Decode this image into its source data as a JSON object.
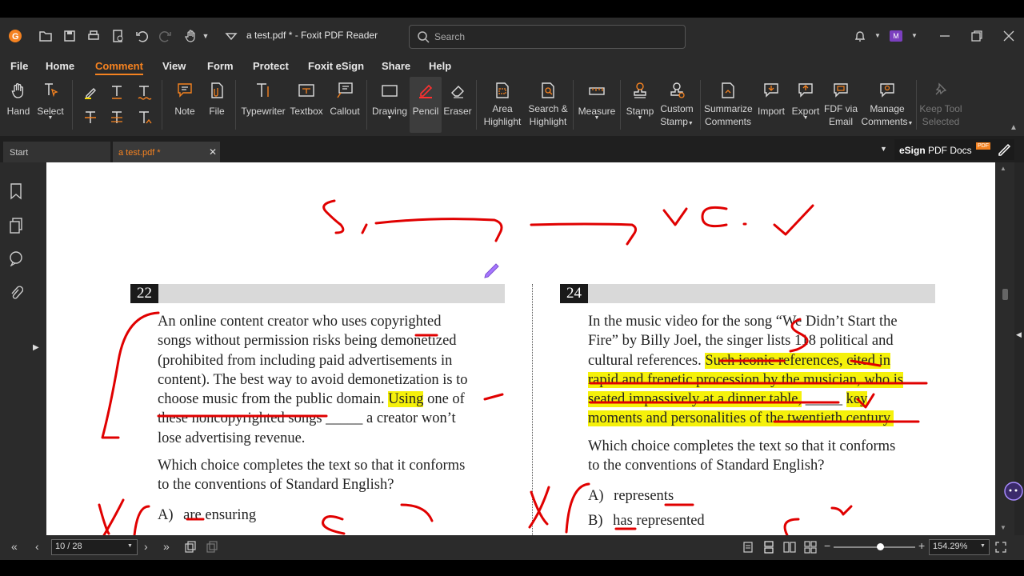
{
  "app": {
    "doc_title": "a test.pdf * - Foxit PDF Reader",
    "search_placeholder": "Search",
    "user_initial": "M"
  },
  "menu": [
    "File",
    "Home",
    "Comment",
    "View",
    "Form",
    "Protect",
    "Foxit eSign",
    "Share",
    "Help"
  ],
  "ribbon": {
    "hand": "Hand",
    "select": "Select",
    "note": "Note",
    "file": "File",
    "typewriter": "Typewriter",
    "textbox": "Textbox",
    "callout": "Callout",
    "drawing": "Drawing",
    "pencil": "Pencil",
    "eraser": "Eraser",
    "area_highlight_1": "Area",
    "area_highlight_2": "Highlight",
    "search_highlight_1": "Search &",
    "search_highlight_2": "Highlight",
    "measure": "Measure",
    "stamp": "Stamp",
    "custom_stamp_1": "Custom",
    "custom_stamp_2": "Stamp",
    "summarize_1": "Summarize",
    "summarize_2": "Comments",
    "import": "Import",
    "export": "Export",
    "fdf_1": "FDF via",
    "fdf_2": "Email",
    "manage_1": "Manage",
    "manage_2": "Comments",
    "keep_1": "Keep Tool",
    "keep_2": "Selected"
  },
  "tabs": {
    "start": "Start",
    "doc": "a test.pdf *",
    "esign_bold": "eSign",
    "esign_rest": " PDF Docs",
    "pdf_badge": "PDF"
  },
  "page": {
    "q22": {
      "num": "22",
      "lines": [
        "An online content creator who uses copyrighted",
        "songs without permission risks being demonetized",
        "(prohibited from including paid advertisements in",
        "content). The best way to avoid demonetization is to"
      ],
      "line5_pre": "choose music from the public domain. ",
      "line5_hl": "Using",
      "line5_post": " one of",
      "line6_strike": "these noncopyrighted songs",
      "line6_post": " _____ a creator won’t",
      "line7": "lose advertising revenue.",
      "prompt_1": "Which choice completes the text so that it conforms",
      "prompt_2": "to the conventions of Standard English?",
      "optA_letter": "A)",
      "optA_text": "are ensuring"
    },
    "q24": {
      "num": "24",
      "line1": "In the music video for the song “We Didn’t Start the",
      "line2": "Fire” by Billy Joel, the singer lists 118 political and",
      "line3_pre": "cultural references. ",
      "line3_hl": "Such iconic references, cited in",
      "line4_hl": "rapid and frenetic procession by the musician, who is",
      "line5_hl": "seated impassively at a dinner table,",
      "line5_blank": " _____ ",
      "line5_hl2": " key",
      "line6_hl": "moments and personalities of the twentieth century.",
      "prompt_1": "Which choice completes the text so that it conforms",
      "prompt_2": "to the conventions of Standard English?",
      "optA_letter": "A)",
      "optA_text": "represents",
      "optB_letter": "B)",
      "optB_text_1": "has",
      "optB_text_2": " represented"
    }
  },
  "status": {
    "page_indicator": "10 / 28",
    "zoom": "154.29%"
  },
  "colors": {
    "accent": "#f58220",
    "ink": "#e00000",
    "highlight": "#f5f10a"
  }
}
